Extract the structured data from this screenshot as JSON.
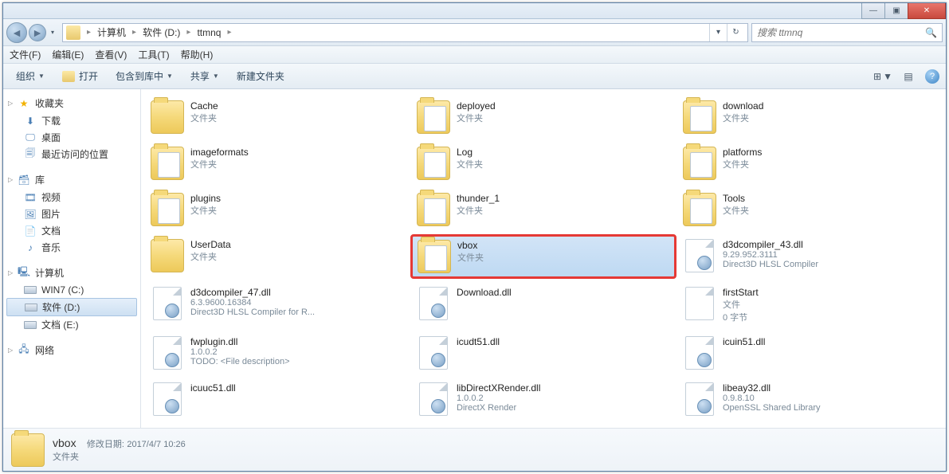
{
  "titlebar": {
    "min": "—",
    "max": "▣",
    "close": "✕"
  },
  "nav": {
    "back_glyph": "◄",
    "fwd_glyph": "►",
    "breadcrumb": [
      "计算机",
      "软件 (D:)",
      "ttmnq"
    ],
    "sep": "▸",
    "addr_dropdown": "▾",
    "refresh": "↻"
  },
  "search": {
    "placeholder": "搜索 ttmnq",
    "glyph": "🔍"
  },
  "menubar": [
    "文件(F)",
    "编辑(E)",
    "查看(V)",
    "工具(T)",
    "帮助(H)"
  ],
  "toolbar": {
    "organize": "组织",
    "open": "打开",
    "include": "包含到库中",
    "share": "共享",
    "newfolder": "新建文件夹",
    "view_glyph": "⊞",
    "preview_glyph": "▤",
    "help_glyph": "?"
  },
  "sidebar": {
    "favorites": {
      "label": "收藏夹",
      "items": [
        "下载",
        "桌面",
        "最近访问的位置"
      ]
    },
    "libraries": {
      "label": "库",
      "items": [
        "视频",
        "图片",
        "文档",
        "音乐"
      ]
    },
    "computer": {
      "label": "计算机",
      "items": [
        "WIN7 (C:)",
        "软件 (D:)",
        "文档 (E:)"
      ]
    },
    "network": {
      "label": "网络"
    }
  },
  "folder_sub": "文件夹",
  "items": [
    [
      {
        "name": "Cache",
        "sub": "文件夹",
        "type": "folder"
      },
      {
        "name": "deployed",
        "sub": "文件夹",
        "type": "folder-sheet"
      },
      {
        "name": "download",
        "sub": "文件夹",
        "type": "folder-sheet"
      }
    ],
    [
      {
        "name": "imageformats",
        "sub": "文件夹",
        "type": "folder-sheet"
      },
      {
        "name": "Log",
        "sub": "文件夹",
        "type": "folder-sheet"
      },
      {
        "name": "platforms",
        "sub": "文件夹",
        "type": "folder-sheet"
      }
    ],
    [
      {
        "name": "plugins",
        "sub": "文件夹",
        "type": "folder-sheet"
      },
      {
        "name": "thunder_1",
        "sub": "文件夹",
        "type": "folder-sheet"
      },
      {
        "name": "Tools",
        "sub": "文件夹",
        "type": "folder-sheet"
      }
    ],
    [
      {
        "name": "UserData",
        "sub": "文件夹",
        "type": "folder"
      },
      {
        "name": "vbox",
        "sub": "文件夹",
        "type": "folder-sheet",
        "selected": true,
        "highlight": true
      },
      {
        "name": "d3dcompiler_43.dll",
        "sub": "9.29.952.3111",
        "sub2": "Direct3D HLSL Compiler",
        "type": "dll"
      }
    ],
    [
      {
        "name": "d3dcompiler_47.dll",
        "sub": "6.3.9600.16384",
        "sub2": "Direct3D HLSL Compiler for R...",
        "type": "dll"
      },
      {
        "name": "Download.dll",
        "sub": "",
        "type": "dll"
      },
      {
        "name": "firstStart",
        "sub": "文件",
        "sub2": "0 字节",
        "type": "file"
      }
    ],
    [
      {
        "name": "fwplugin.dll",
        "sub": "1.0.0.2",
        "sub2": "TODO: <File description>",
        "type": "dll"
      },
      {
        "name": "icudt51.dll",
        "sub": "",
        "type": "dll"
      },
      {
        "name": "icuin51.dll",
        "sub": "",
        "type": "dll"
      }
    ],
    [
      {
        "name": "icuuc51.dll",
        "sub": "",
        "type": "dll"
      },
      {
        "name": "libDirectXRender.dll",
        "sub": "1.0.0.2",
        "sub2": "DirectX Render",
        "type": "dll"
      },
      {
        "name": "libeay32.dll",
        "sub": "0.9.8.10",
        "sub2": "OpenSSL Shared Library",
        "type": "dll"
      }
    ]
  ],
  "details": {
    "name": "vbox",
    "mod_label": "修改日期:",
    "mod_value": "2017/4/7 10:26",
    "type": "文件夹"
  }
}
